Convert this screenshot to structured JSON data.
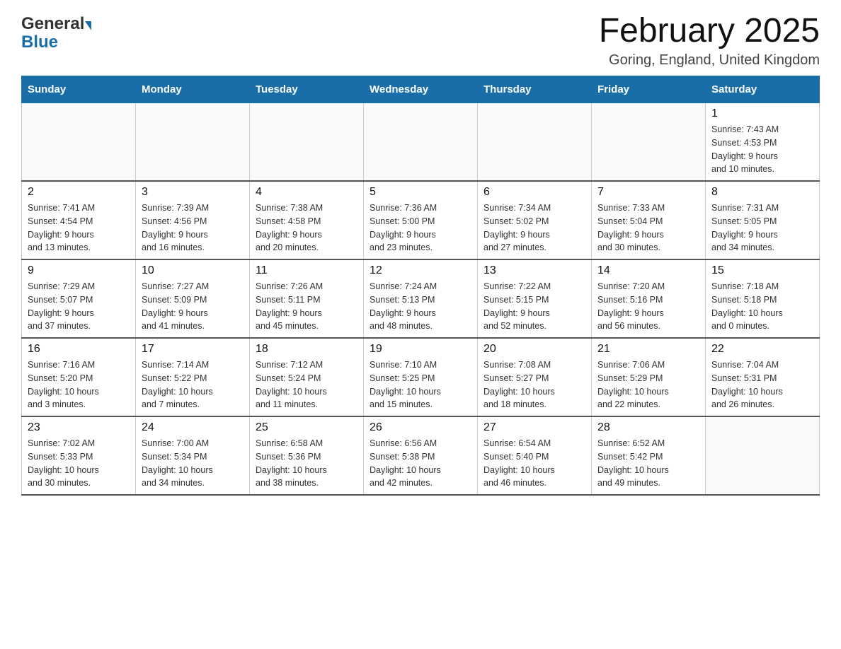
{
  "logo": {
    "general": "General",
    "blue": "Blue"
  },
  "title": "February 2025",
  "location": "Goring, England, United Kingdom",
  "weekdays": [
    "Sunday",
    "Monday",
    "Tuesday",
    "Wednesday",
    "Thursday",
    "Friday",
    "Saturday"
  ],
  "weeks": [
    [
      {
        "day": "",
        "info": ""
      },
      {
        "day": "",
        "info": ""
      },
      {
        "day": "",
        "info": ""
      },
      {
        "day": "",
        "info": ""
      },
      {
        "day": "",
        "info": ""
      },
      {
        "day": "",
        "info": ""
      },
      {
        "day": "1",
        "info": "Sunrise: 7:43 AM\nSunset: 4:53 PM\nDaylight: 9 hours\nand 10 minutes."
      }
    ],
    [
      {
        "day": "2",
        "info": "Sunrise: 7:41 AM\nSunset: 4:54 PM\nDaylight: 9 hours\nand 13 minutes."
      },
      {
        "day": "3",
        "info": "Sunrise: 7:39 AM\nSunset: 4:56 PM\nDaylight: 9 hours\nand 16 minutes."
      },
      {
        "day": "4",
        "info": "Sunrise: 7:38 AM\nSunset: 4:58 PM\nDaylight: 9 hours\nand 20 minutes."
      },
      {
        "day": "5",
        "info": "Sunrise: 7:36 AM\nSunset: 5:00 PM\nDaylight: 9 hours\nand 23 minutes."
      },
      {
        "day": "6",
        "info": "Sunrise: 7:34 AM\nSunset: 5:02 PM\nDaylight: 9 hours\nand 27 minutes."
      },
      {
        "day": "7",
        "info": "Sunrise: 7:33 AM\nSunset: 5:04 PM\nDaylight: 9 hours\nand 30 minutes."
      },
      {
        "day": "8",
        "info": "Sunrise: 7:31 AM\nSunset: 5:05 PM\nDaylight: 9 hours\nand 34 minutes."
      }
    ],
    [
      {
        "day": "9",
        "info": "Sunrise: 7:29 AM\nSunset: 5:07 PM\nDaylight: 9 hours\nand 37 minutes."
      },
      {
        "day": "10",
        "info": "Sunrise: 7:27 AM\nSunset: 5:09 PM\nDaylight: 9 hours\nand 41 minutes."
      },
      {
        "day": "11",
        "info": "Sunrise: 7:26 AM\nSunset: 5:11 PM\nDaylight: 9 hours\nand 45 minutes."
      },
      {
        "day": "12",
        "info": "Sunrise: 7:24 AM\nSunset: 5:13 PM\nDaylight: 9 hours\nand 48 minutes."
      },
      {
        "day": "13",
        "info": "Sunrise: 7:22 AM\nSunset: 5:15 PM\nDaylight: 9 hours\nand 52 minutes."
      },
      {
        "day": "14",
        "info": "Sunrise: 7:20 AM\nSunset: 5:16 PM\nDaylight: 9 hours\nand 56 minutes."
      },
      {
        "day": "15",
        "info": "Sunrise: 7:18 AM\nSunset: 5:18 PM\nDaylight: 10 hours\nand 0 minutes."
      }
    ],
    [
      {
        "day": "16",
        "info": "Sunrise: 7:16 AM\nSunset: 5:20 PM\nDaylight: 10 hours\nand 3 minutes."
      },
      {
        "day": "17",
        "info": "Sunrise: 7:14 AM\nSunset: 5:22 PM\nDaylight: 10 hours\nand 7 minutes."
      },
      {
        "day": "18",
        "info": "Sunrise: 7:12 AM\nSunset: 5:24 PM\nDaylight: 10 hours\nand 11 minutes."
      },
      {
        "day": "19",
        "info": "Sunrise: 7:10 AM\nSunset: 5:25 PM\nDaylight: 10 hours\nand 15 minutes."
      },
      {
        "day": "20",
        "info": "Sunrise: 7:08 AM\nSunset: 5:27 PM\nDaylight: 10 hours\nand 18 minutes."
      },
      {
        "day": "21",
        "info": "Sunrise: 7:06 AM\nSunset: 5:29 PM\nDaylight: 10 hours\nand 22 minutes."
      },
      {
        "day": "22",
        "info": "Sunrise: 7:04 AM\nSunset: 5:31 PM\nDaylight: 10 hours\nand 26 minutes."
      }
    ],
    [
      {
        "day": "23",
        "info": "Sunrise: 7:02 AM\nSunset: 5:33 PM\nDaylight: 10 hours\nand 30 minutes."
      },
      {
        "day": "24",
        "info": "Sunrise: 7:00 AM\nSunset: 5:34 PM\nDaylight: 10 hours\nand 34 minutes."
      },
      {
        "day": "25",
        "info": "Sunrise: 6:58 AM\nSunset: 5:36 PM\nDaylight: 10 hours\nand 38 minutes."
      },
      {
        "day": "26",
        "info": "Sunrise: 6:56 AM\nSunset: 5:38 PM\nDaylight: 10 hours\nand 42 minutes."
      },
      {
        "day": "27",
        "info": "Sunrise: 6:54 AM\nSunset: 5:40 PM\nDaylight: 10 hours\nand 46 minutes."
      },
      {
        "day": "28",
        "info": "Sunrise: 6:52 AM\nSunset: 5:42 PM\nDaylight: 10 hours\nand 49 minutes."
      },
      {
        "day": "",
        "info": ""
      }
    ]
  ]
}
